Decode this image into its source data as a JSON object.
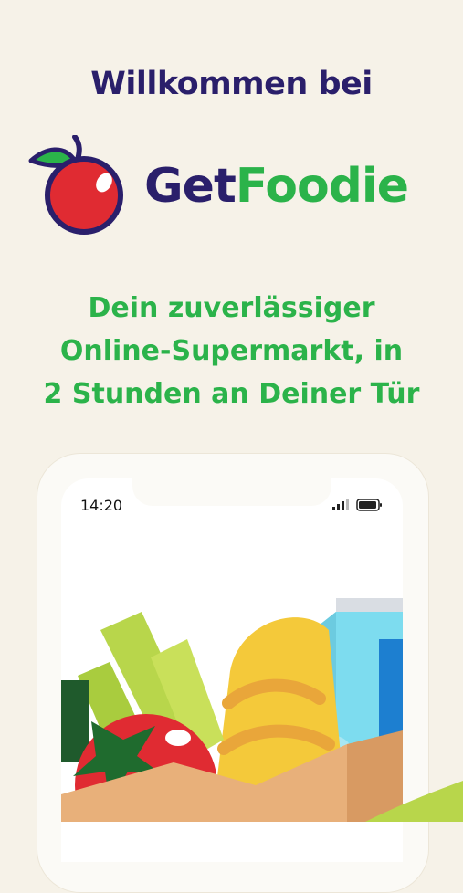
{
  "heading": {
    "welcome": "Willkommen bei"
  },
  "logo": {
    "part1": "Get",
    "part2": "Foodie",
    "icon": "apple-icon"
  },
  "tagline": {
    "line1": "Dein zuverlässiger",
    "line2": "Online-Supermarkt, in",
    "line3": "2 Stunden an Deiner Tür"
  },
  "phone": {
    "time": "14:20",
    "icons": [
      "signal-icon",
      "battery-icon"
    ]
  },
  "colors": {
    "background": "#f6f2e8",
    "brand_navy": "#2a1f6b",
    "brand_green": "#2bb34a",
    "apple_red": "#e02b32"
  }
}
